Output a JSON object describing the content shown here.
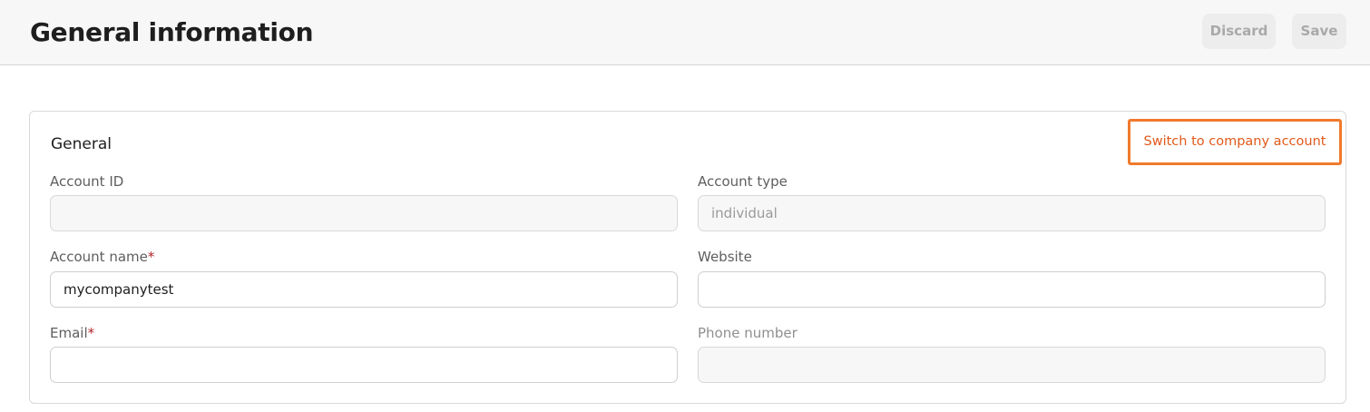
{
  "header": {
    "title": "General information",
    "discard_label": "Discard",
    "save_label": "Save"
  },
  "general": {
    "title": "General",
    "switch_label": "Switch to company account",
    "fields": {
      "account_id": {
        "label": "Account ID",
        "value": ""
      },
      "account_type": {
        "label": "Account type",
        "value": "individual"
      },
      "account_name": {
        "label": "Account name",
        "required_mark": "*",
        "value": "mycompanytest"
      },
      "website": {
        "label": "Website",
        "value": ""
      },
      "email": {
        "label": "Email",
        "required_mark": "*",
        "value": ""
      },
      "phone_number": {
        "label": "Phone number",
        "value": ""
      }
    }
  },
  "colors": {
    "accent": "#f07a2c",
    "accent_text": "#e2591a",
    "required": "#b0252b"
  }
}
